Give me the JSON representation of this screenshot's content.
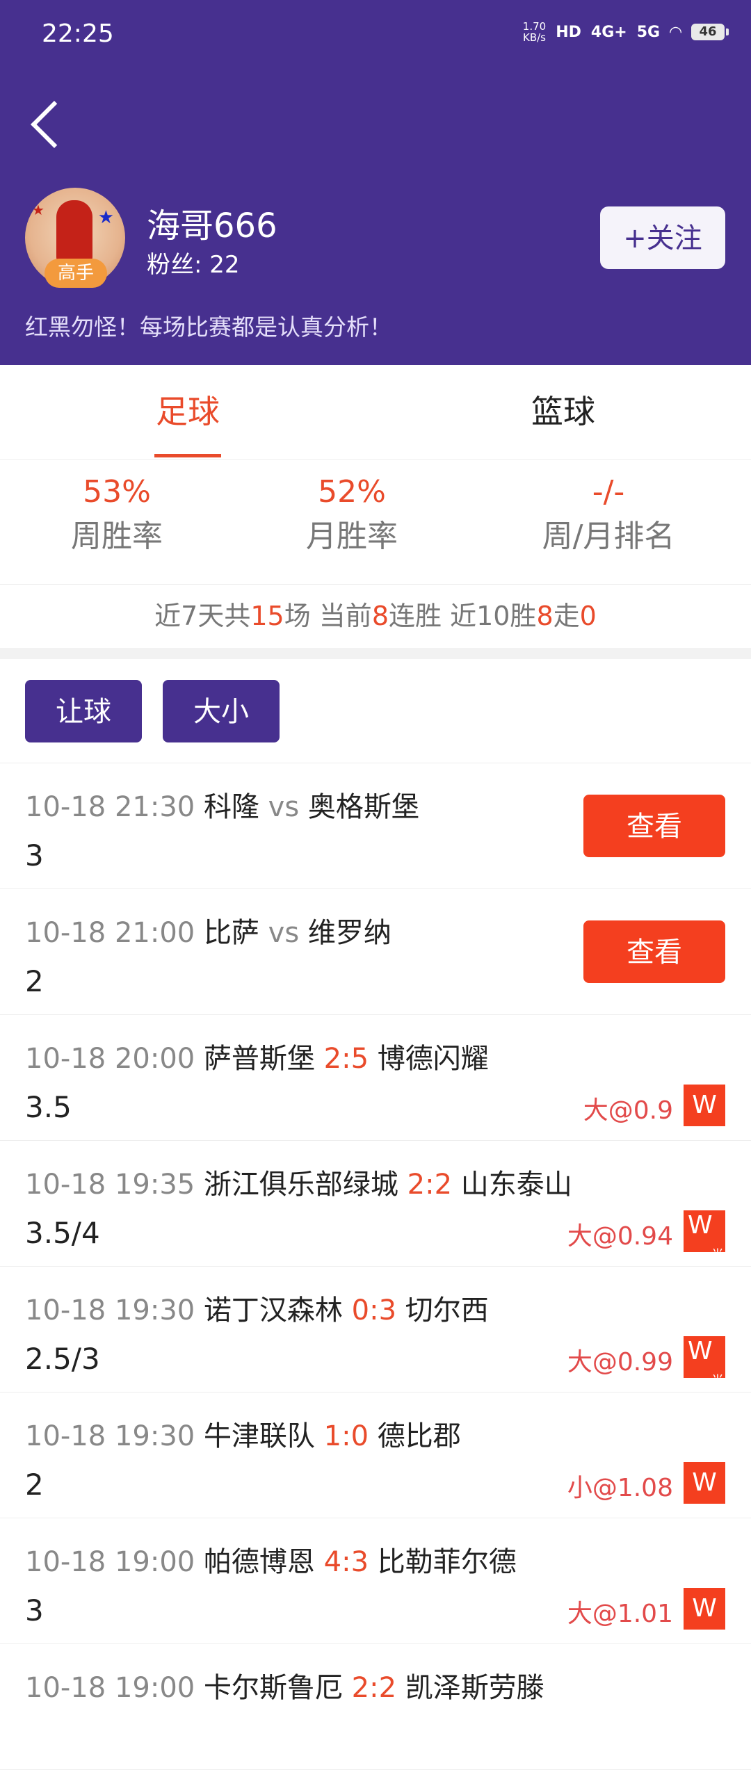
{
  "status": {
    "time": "22:25",
    "speed_value": "1.70",
    "speed_unit": "KB/s",
    "hd": "HD",
    "net1": "4G+",
    "net2": "5G",
    "battery": "46"
  },
  "profile": {
    "name": "海哥666",
    "fans_label": "粉丝: 22",
    "badge": "高手",
    "follow_label": "+关注",
    "bio": "红黑勿怪！每场比赛都是认真分析！"
  },
  "tabs": [
    {
      "label": "足球",
      "active": true
    },
    {
      "label": "篮球",
      "active": false
    }
  ],
  "stats": [
    {
      "value": "53%",
      "label": "周胜率"
    },
    {
      "value": "52%",
      "label": "月胜率"
    },
    {
      "value": "-/-",
      "label": "周/月排名"
    }
  ],
  "streak": {
    "p1": "近7天共",
    "n1": "15",
    "p2": "场  当前",
    "n2": "8",
    "p3": "连胜  近10胜",
    "n3": "8",
    "p4": "走",
    "n4": "0"
  },
  "filters": [
    "让球",
    "大小"
  ],
  "matches": [
    {
      "time": "10-18 21:30",
      "home": "科隆",
      "mid": "vs",
      "away": "奥格斯堡",
      "line": "3",
      "button": "查看"
    },
    {
      "time": "10-18 21:00",
      "home": "比萨",
      "mid": "vs",
      "away": "维罗纳",
      "line": "2",
      "button": "查看"
    },
    {
      "time": "10-18 20:00",
      "home": "萨普斯堡",
      "mid": "2:5",
      "away": "博德闪耀",
      "line": "3.5",
      "odds": "大@0.9",
      "result": "W"
    },
    {
      "time": "10-18 19:35",
      "home": "浙江俱乐部绿城",
      "mid": "2:2",
      "away": "山东泰山",
      "line": "3.5/4",
      "odds": "大@0.94",
      "result": "W",
      "half": "半"
    },
    {
      "time": "10-18 19:30",
      "home": "诺丁汉森林",
      "mid": "0:3",
      "away": "切尔西",
      "line": "2.5/3",
      "odds": "大@0.99",
      "result": "W",
      "half": "半"
    },
    {
      "time": "10-18 19:30",
      "home": "牛津联队",
      "mid": "1:0",
      "away": "德比郡",
      "line": "2",
      "odds": "小@1.08",
      "result": "W"
    },
    {
      "time": "10-18 19:00",
      "home": "帕德博恩",
      "mid": "4:3",
      "away": "比勒菲尔德",
      "line": "3",
      "odds": "大@1.01",
      "result": "W"
    },
    {
      "time": "10-18 19:00",
      "home": "卡尔斯鲁厄",
      "mid": "2:2",
      "away": "凯泽斯劳滕",
      "line": "",
      "odds": "",
      "result": ""
    }
  ]
}
